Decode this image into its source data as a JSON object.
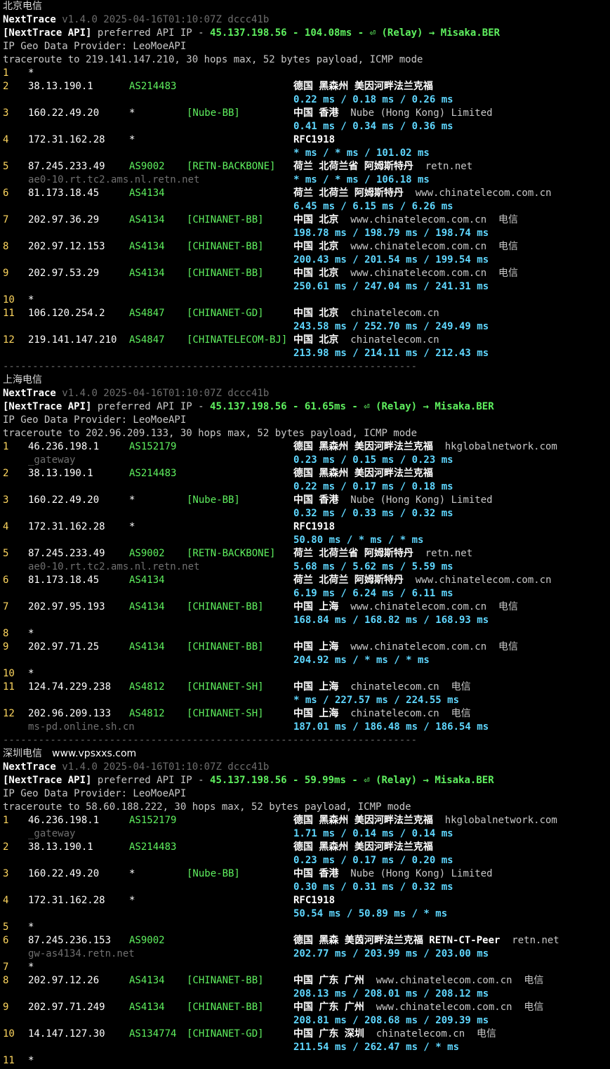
{
  "sections": [
    {
      "title": "北京电信",
      "site": "",
      "nexttrace": "NextTrace",
      "version": "v1.4.0 2025-04-16T01:10:07Z dccc41b",
      "api_prefix": "[NextTrace API]",
      "api_text": " preferred API IP - ",
      "api_ip": "45.137.198.56",
      "api_sep": " - ",
      "api_latency": "104.08ms",
      "api_relay": " - ⏎ (Relay) → Misaka.BER",
      "geo_provider": "IP Geo Data Provider: LeoMoeAPI",
      "trace": "traceroute to 219.141.147.210, 30 hops max, 52 bytes payload, ICMP mode",
      "hops": [
        {
          "n": "1",
          "ip": "*",
          "asn": "",
          "tag": "",
          "geo": "",
          "org": "",
          "host": "",
          "rtt": ""
        },
        {
          "n": "2",
          "ip": "38.13.190.1",
          "asn": "AS214483",
          "tag": "",
          "geo": "德国 黑森州 美因河畔法兰克福",
          "org": "",
          "host": "",
          "rtt": "0.22 ms / 0.18 ms / 0.26 ms"
        },
        {
          "n": "3",
          "ip": "160.22.49.20",
          "asn": "*",
          "tag": "[Nube-BB]",
          "geo": "中国 香港",
          "org": "Nube (Hong Kong) Limited",
          "host": "",
          "rtt": "0.41 ms / 0.34 ms / 0.36 ms"
        },
        {
          "n": "4",
          "ip": "172.31.162.28",
          "asn": "*",
          "tag": "",
          "geo": "RFC1918",
          "org": "",
          "host": "",
          "rtt": "* ms / * ms / 101.02 ms"
        },
        {
          "n": "5",
          "ip": "87.245.233.49",
          "asn": "AS9002",
          "tag": "[RETN-BACKBONE]",
          "geo": "荷兰 北荷兰省 阿姆斯特丹",
          "org": "retn.net",
          "host": "ae0-10.rt.tc2.ams.nl.retn.net",
          "rtt": "* ms / * ms / 106.18 ms"
        },
        {
          "n": "6",
          "ip": "81.173.18.45",
          "asn": "AS4134",
          "tag": "",
          "geo": "荷兰 北荷兰 阿姆斯特丹",
          "org": "www.chinatelecom.com.cn",
          "host": "",
          "rtt": "6.45 ms / 6.15 ms / 6.26 ms"
        },
        {
          "n": "7",
          "ip": "202.97.36.29",
          "asn": "AS4134",
          "tag": "[CHINANET-BB]",
          "geo": "中国 北京",
          "org": "www.chinatelecom.com.cn  电信",
          "host": "",
          "rtt": "198.78 ms / 198.79 ms / 198.74 ms"
        },
        {
          "n": "8",
          "ip": "202.97.12.153",
          "asn": "AS4134",
          "tag": "[CHINANET-BB]",
          "geo": "中国 北京",
          "org": "www.chinatelecom.com.cn  电信",
          "host": "",
          "rtt": "200.43 ms / 201.54 ms / 199.54 ms"
        },
        {
          "n": "9",
          "ip": "202.97.53.29",
          "asn": "AS4134",
          "tag": "[CHINANET-BB]",
          "geo": "中国 北京",
          "org": "www.chinatelecom.com.cn  电信",
          "host": "",
          "rtt": "250.61 ms / 247.04 ms / 241.31 ms"
        },
        {
          "n": "10",
          "ip": "*",
          "asn": "",
          "tag": "",
          "geo": "",
          "org": "",
          "host": "",
          "rtt": ""
        },
        {
          "n": "11",
          "ip": "106.120.254.2",
          "asn": "AS4847",
          "tag": "[CHINANET-GD]",
          "geo": "中国 北京",
          "org": "chinatelecom.cn",
          "host": "",
          "rtt": "243.58 ms / 252.70 ms / 249.49 ms"
        },
        {
          "n": "12",
          "ip": "219.141.147.210",
          "asn": "AS4847",
          "tag": "[CHINATELECOM-BJ]",
          "geo": "中国 北京",
          "org": "chinatelecom.cn",
          "host": "",
          "rtt": "213.98 ms / 214.11 ms / 212.43 ms"
        }
      ]
    },
    {
      "title": "上海电信",
      "site": "",
      "nexttrace": "NextTrace",
      "version": "v1.4.0 2025-04-16T01:10:07Z dccc41b",
      "api_prefix": "[NextTrace API]",
      "api_text": " preferred API IP - ",
      "api_ip": "45.137.198.56",
      "api_sep": " - ",
      "api_latency": "61.65ms",
      "api_relay": " - ⏎ (Relay) → Misaka.BER",
      "geo_provider": "IP Geo Data Provider: LeoMoeAPI",
      "trace": "traceroute to 202.96.209.133, 30 hops max, 52 bytes payload, ICMP mode",
      "hops": [
        {
          "n": "1",
          "ip": "46.236.198.1",
          "asn": "AS152179",
          "tag": "",
          "geo": "德国 黑森州 美因河畔法兰克福",
          "org": "hkglobalnetwork.com",
          "host": "_gateway",
          "rtt": "0.23 ms / 0.15 ms / 0.23 ms"
        },
        {
          "n": "2",
          "ip": "38.13.190.1",
          "asn": "AS214483",
          "tag": "",
          "geo": "德国 黑森州 美因河畔法兰克福",
          "org": "",
          "host": "",
          "rtt": "0.22 ms / 0.17 ms / 0.18 ms"
        },
        {
          "n": "3",
          "ip": "160.22.49.20",
          "asn": "*",
          "tag": "[Nube-BB]",
          "geo": "中国 香港",
          "org": "Nube (Hong Kong) Limited",
          "host": "",
          "rtt": "0.32 ms / 0.33 ms / 0.32 ms"
        },
        {
          "n": "4",
          "ip": "172.31.162.28",
          "asn": "*",
          "tag": "",
          "geo": "RFC1918",
          "org": "",
          "host": "",
          "rtt": "50.80 ms / * ms / * ms"
        },
        {
          "n": "5",
          "ip": "87.245.233.49",
          "asn": "AS9002",
          "tag": "[RETN-BACKBONE]",
          "geo": "荷兰 北荷兰省 阿姆斯特丹",
          "org": "retn.net",
          "host": "ae0-10.rt.tc2.ams.nl.retn.net",
          "rtt": "5.68 ms / 5.62 ms / 5.59 ms"
        },
        {
          "n": "6",
          "ip": "81.173.18.45",
          "asn": "AS4134",
          "tag": "",
          "geo": "荷兰 北荷兰 阿姆斯特丹",
          "org": "www.chinatelecom.com.cn",
          "host": "",
          "rtt": "6.19 ms / 6.24 ms / 6.11 ms"
        },
        {
          "n": "7",
          "ip": "202.97.95.193",
          "asn": "AS4134",
          "tag": "[CHINANET-BB]",
          "geo": "中国 上海",
          "org": "www.chinatelecom.com.cn  电信",
          "host": "",
          "rtt": "168.84 ms / 168.82 ms / 168.93 ms"
        },
        {
          "n": "8",
          "ip": "*",
          "asn": "",
          "tag": "",
          "geo": "",
          "org": "",
          "host": "",
          "rtt": ""
        },
        {
          "n": "9",
          "ip": "202.97.71.25",
          "asn": "AS4134",
          "tag": "[CHINANET-BB]",
          "geo": "中国 上海",
          "org": "www.chinatelecom.com.cn  电信",
          "host": "",
          "rtt": "204.92 ms / * ms / * ms"
        },
        {
          "n": "10",
          "ip": "*",
          "asn": "",
          "tag": "",
          "geo": "",
          "org": "",
          "host": "",
          "rtt": ""
        },
        {
          "n": "11",
          "ip": "124.74.229.238",
          "asn": "AS4812",
          "tag": "[CHINANET-SH]",
          "geo": "中国 上海",
          "org": "chinatelecom.cn  电信",
          "host": "",
          "rtt": "* ms / 227.57 ms / 224.55 ms"
        },
        {
          "n": "12",
          "ip": "202.96.209.133",
          "asn": "AS4812",
          "tag": "[CHINANET-SH]",
          "geo": "中国 上海",
          "org": "chinatelecom.cn  电信",
          "host": "ms-pd.online.sh.cn",
          "rtt": "187.01 ms / 186.48 ms / 186.54 ms"
        }
      ]
    },
    {
      "title": "深圳电信",
      "site": "www.vpsxxs.com",
      "nexttrace": "NextTrace",
      "version": "v1.4.0 2025-04-16T01:10:07Z dccc41b",
      "api_prefix": "[NextTrace API]",
      "api_text": " preferred API IP - ",
      "api_ip": "45.137.198.56",
      "api_sep": " - ",
      "api_latency": "59.99ms",
      "api_relay": " - ⏎ (Relay) → Misaka.BER",
      "geo_provider": "IP Geo Data Provider: LeoMoeAPI",
      "trace": "traceroute to 58.60.188.222, 30 hops max, 52 bytes payload, ICMP mode",
      "hops": [
        {
          "n": "1",
          "ip": "46.236.198.1",
          "asn": "AS152179",
          "tag": "",
          "geo": "德国 黑森州 美因河畔法兰克福",
          "org": "hkglobalnetwork.com",
          "host": "_gateway",
          "rtt": "1.71 ms / 0.14 ms / 0.14 ms"
        },
        {
          "n": "2",
          "ip": "38.13.190.1",
          "asn": "AS214483",
          "tag": "",
          "geo": "德国 黑森州 美因河畔法兰克福",
          "org": "",
          "host": "",
          "rtt": "0.23 ms / 0.17 ms / 0.20 ms"
        },
        {
          "n": "3",
          "ip": "160.22.49.20",
          "asn": "*",
          "tag": "[Nube-BB]",
          "geo": "中国 香港",
          "org": "Nube (Hong Kong) Limited",
          "host": "",
          "rtt": "0.30 ms / 0.31 ms / 0.32 ms"
        },
        {
          "n": "4",
          "ip": "172.31.162.28",
          "asn": "*",
          "tag": "",
          "geo": "RFC1918",
          "org": "",
          "host": "",
          "rtt": "50.54 ms / 50.89 ms / * ms"
        },
        {
          "n": "5",
          "ip": "*",
          "asn": "",
          "tag": "",
          "geo": "",
          "org": "",
          "host": "",
          "rtt": ""
        },
        {
          "n": "6",
          "ip": "87.245.236.153",
          "asn": "AS9002",
          "tag": "",
          "geo": "德国 黑森 美茵河畔法兰克福 RETN-CT-Peer",
          "org": "retn.net",
          "host": "gw-as4134.retn.net",
          "rtt": "202.77 ms / 203.99 ms / 203.00 ms"
        },
        {
          "n": "7",
          "ip": "*",
          "asn": "",
          "tag": "",
          "geo": "",
          "org": "",
          "host": "",
          "rtt": ""
        },
        {
          "n": "8",
          "ip": "202.97.12.26",
          "asn": "AS4134",
          "tag": "[CHINANET-BB]",
          "geo": "中国 广东 广州",
          "org": "www.chinatelecom.com.cn  电信",
          "host": "",
          "rtt": "208.13 ms / 208.01 ms / 208.12 ms"
        },
        {
          "n": "9",
          "ip": "202.97.71.249",
          "asn": "AS4134",
          "tag": "[CHINANET-BB]",
          "geo": "中国 广东 广州",
          "org": "www.chinatelecom.com.cn  电信",
          "host": "",
          "rtt": "208.81 ms / 208.68 ms / 209.39 ms"
        },
        {
          "n": "10",
          "ip": "14.147.127.30",
          "asn": "AS134774",
          "tag": "[CHINANET-GD]",
          "geo": "中国 广东 深圳",
          "org": "chinatelecom.cn  电信",
          "host": "",
          "rtt": "211.54 ms / 262.47 ms / * ms"
        },
        {
          "n": "11",
          "ip": "*",
          "asn": "",
          "tag": "",
          "geo": "",
          "org": "",
          "host": "",
          "rtt": ""
        }
      ]
    }
  ],
  "separator": "----------------------------------------------------------------------",
  "colors": {
    "background": "#000000",
    "asn": "#5ff05f",
    "hop_number": "#ffd75f",
    "rtt": "#5fd7ff",
    "hostname": "#707070"
  }
}
